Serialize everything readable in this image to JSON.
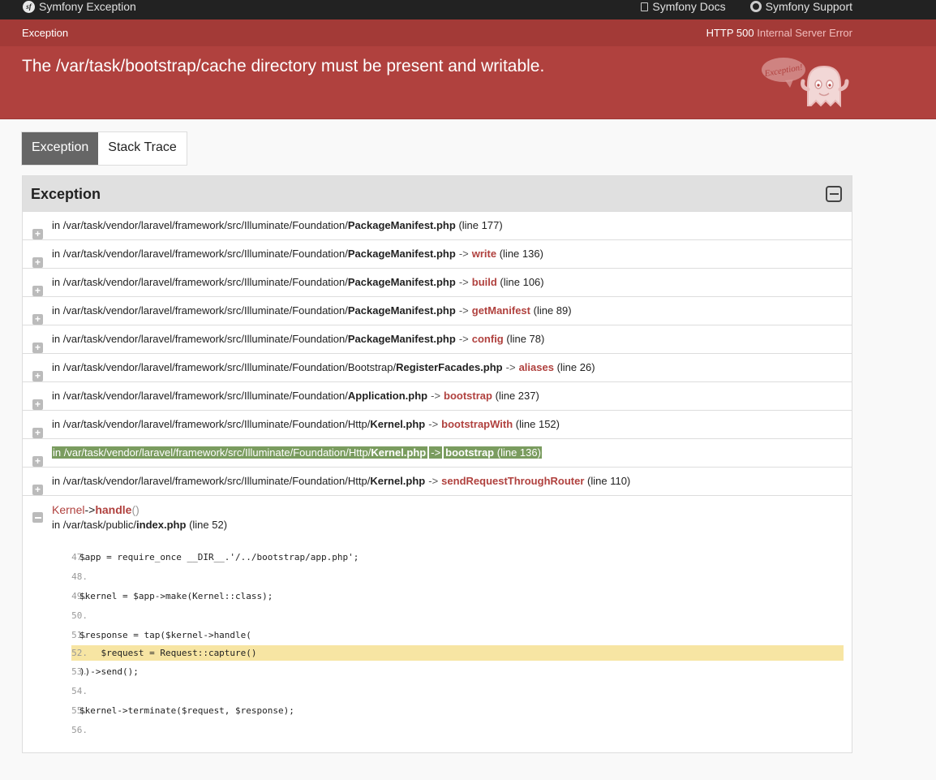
{
  "topbar": {
    "brand": "Symfony Exception",
    "logo_text": "sf",
    "docs": "Symfony Docs",
    "support": "Symfony Support"
  },
  "summary": {
    "kind": "Exception",
    "status_code": "HTTP 500",
    "status_text": "Internal Server Error",
    "message": "The /var/task/bootstrap/cache directory must be present and writable.",
    "ghost_label": "Exception!"
  },
  "tabs": [
    {
      "label": "Exception",
      "active": true
    },
    {
      "label": "Stack Trace",
      "active": false
    }
  ],
  "panel": {
    "title": "Exception",
    "trace": [
      {
        "prefix": "in /var/task/vendor/laravel/framework/src/Illuminate/Foundation/",
        "file": "PackageManifest.php",
        "arrow": "",
        "fn": "",
        "line": "(line 177)"
      },
      {
        "prefix": "in /var/task/vendor/laravel/framework/src/Illuminate/Foundation/",
        "file": "PackageManifest.php",
        "arrow": "->",
        "fn": "write",
        "line": "(line 136)"
      },
      {
        "prefix": "in /var/task/vendor/laravel/framework/src/Illuminate/Foundation/",
        "file": "PackageManifest.php",
        "arrow": "->",
        "fn": "build",
        "line": "(line 106)"
      },
      {
        "prefix": "in /var/task/vendor/laravel/framework/src/Illuminate/Foundation/",
        "file": "PackageManifest.php",
        "arrow": "->",
        "fn": "getManifest",
        "line": "(line 89)"
      },
      {
        "prefix": "in /var/task/vendor/laravel/framework/src/Illuminate/Foundation/",
        "file": "PackageManifest.php",
        "arrow": "->",
        "fn": "config",
        "line": "(line 78)"
      },
      {
        "prefix": "in /var/task/vendor/laravel/framework/src/Illuminate/Foundation/Bootstrap/",
        "file": "RegisterFacades.php",
        "arrow": "->",
        "fn": "aliases",
        "line": "(line 26)"
      },
      {
        "prefix": "in /var/task/vendor/laravel/framework/src/Illuminate/Foundation/",
        "file": "Application.php",
        "arrow": "->",
        "fn": "bootstrap",
        "line": "(line 237)"
      },
      {
        "prefix": "in /var/task/vendor/laravel/framework/src/Illuminate/Foundation/Http/",
        "file": "Kernel.php",
        "arrow": "->",
        "fn": "bootstrapWith",
        "line": "(line 152)"
      },
      {
        "prefix": "in /var/task/vendor/laravel/framework/src/Illuminate/Foundation/Http/",
        "file": "Kernel.php",
        "arrow": "->",
        "fn": "bootstrap",
        "line": "(line 136)",
        "highlighted": true
      },
      {
        "prefix": "in /var/task/vendor/laravel/framework/src/Illuminate/Foundation/Http/",
        "file": "Kernel.php",
        "arrow": "->",
        "fn": "sendRequestThroughRouter",
        "line": "(line 110)"
      }
    ],
    "last": {
      "class": "Kernel",
      "arrow": "->",
      "fn": "handle",
      "paren": "()",
      "loc_prefix": "in /var/task/public/",
      "loc_file": "index.php",
      "loc_line": "(line 52)"
    },
    "code": [
      {
        "num": "47.",
        "src": "$app = require_once __DIR__.'/../bootstrap/app.php';"
      },
      {
        "num": "48.",
        "src": ""
      },
      {
        "num": "49.",
        "src": "$kernel = $app->make(Kernel::class);"
      },
      {
        "num": "50.",
        "src": ""
      },
      {
        "num": "51.",
        "src": "$response = tap($kernel->handle("
      },
      {
        "num": "52.",
        "src": "    $request = Request::capture()",
        "highlighted": true
      },
      {
        "num": "53.",
        "src": "))->send();"
      },
      {
        "num": "54.",
        "src": ""
      },
      {
        "num": "55.",
        "src": "$kernel->terminate($request, $response);"
      },
      {
        "num": "56.",
        "src": ""
      }
    ]
  }
}
